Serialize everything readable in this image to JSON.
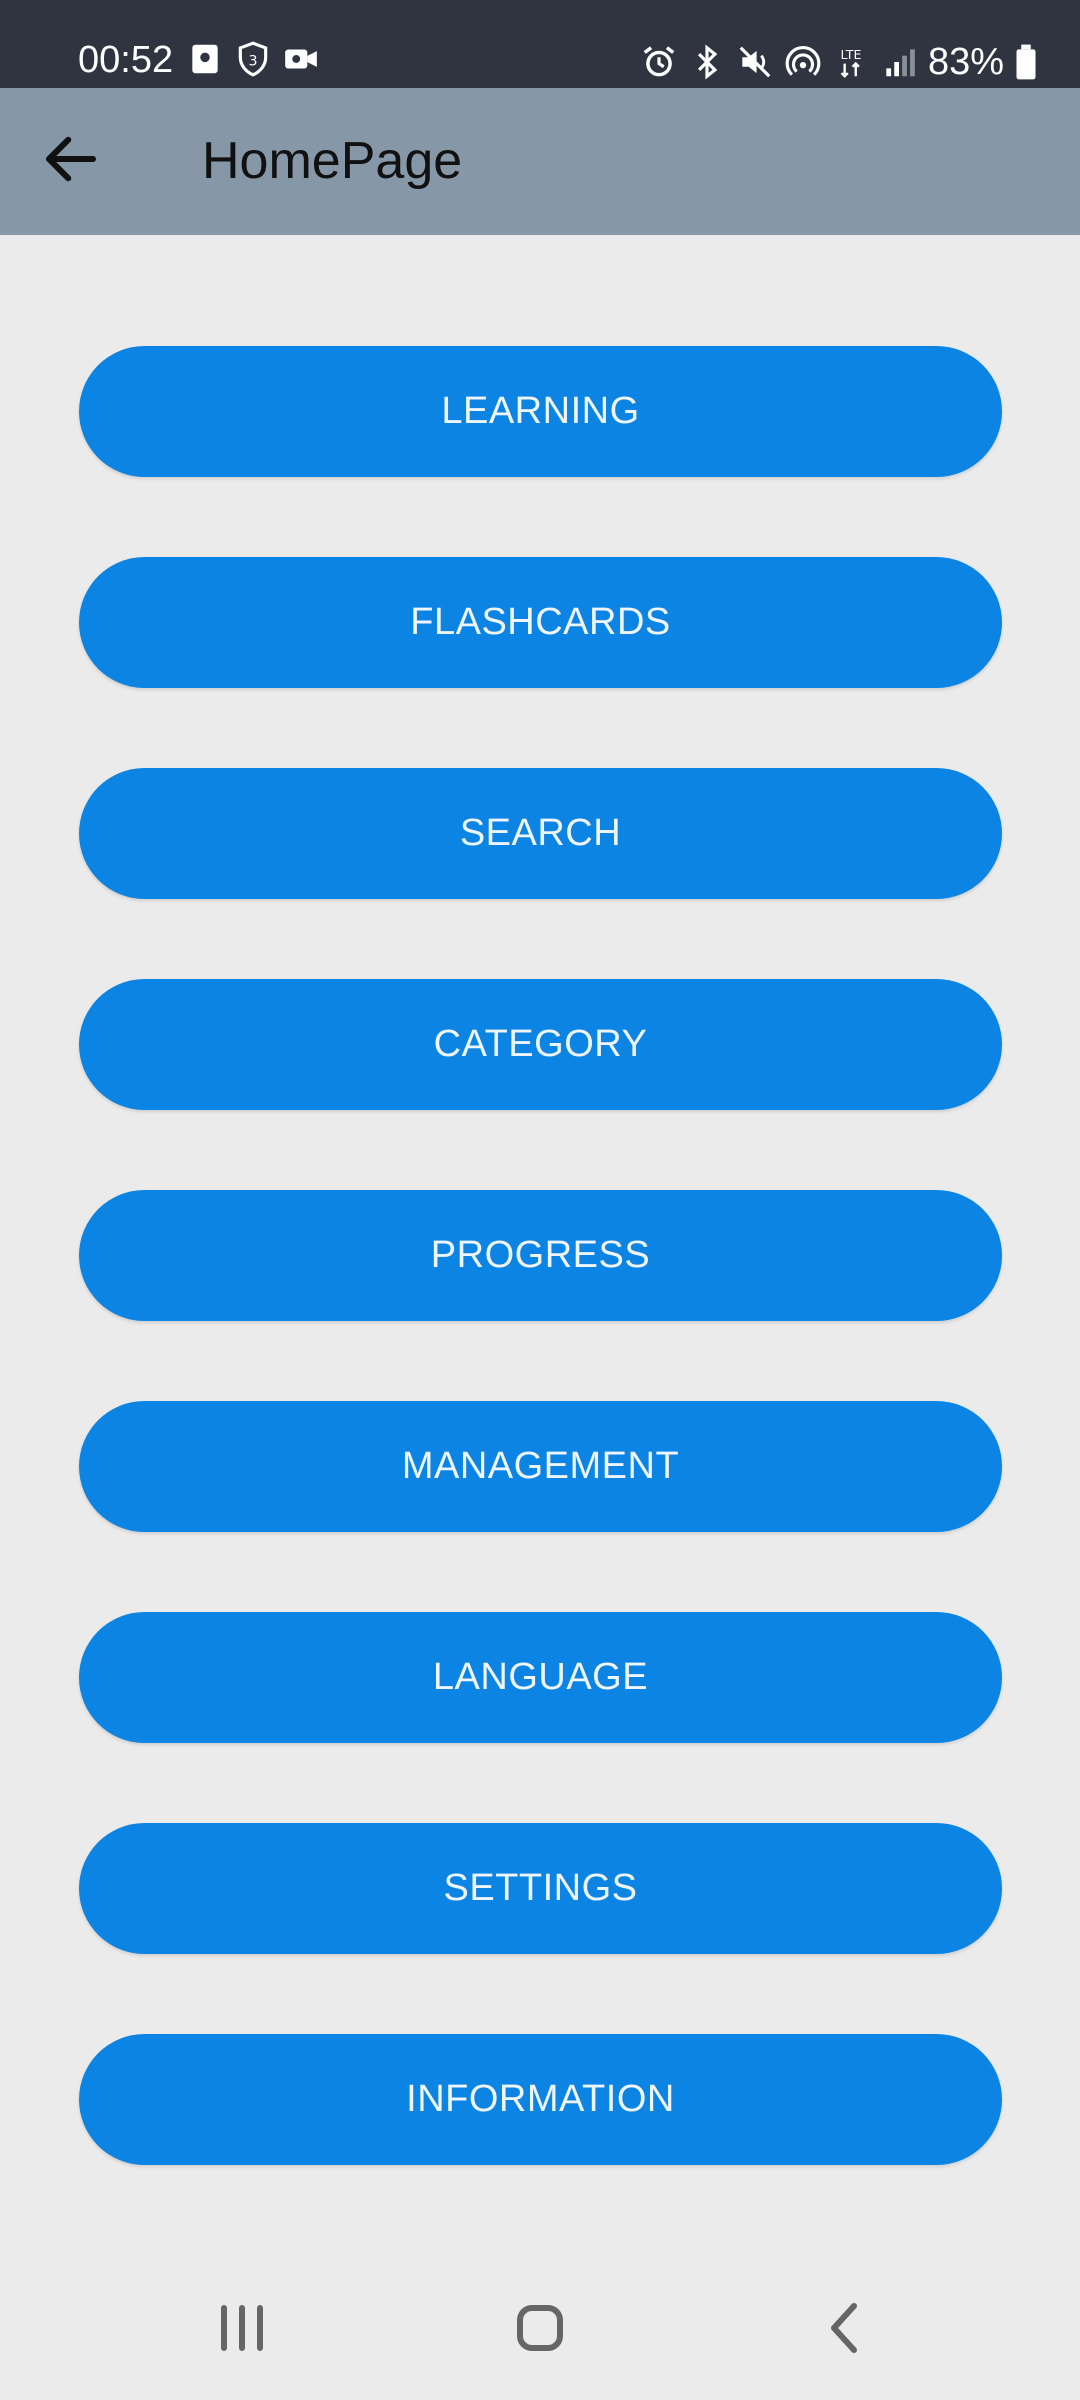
{
  "status_bar": {
    "time": "00:52",
    "battery_percent": "83%",
    "left_icons": [
      "notification-icon",
      "shield-3-icon",
      "video-record-icon"
    ],
    "right_icons": [
      "alarm-icon",
      "bluetooth-icon",
      "mute-icon",
      "hotspot-icon",
      "lte-icon",
      "signal-icon",
      "battery-icon"
    ]
  },
  "app_bar": {
    "title": "HomePage",
    "back_icon": "arrow-left-icon"
  },
  "menu": {
    "items": [
      {
        "label": "LEARNING"
      },
      {
        "label": "FLASHCARDS"
      },
      {
        "label": "SEARCH"
      },
      {
        "label": "CATEGORY"
      },
      {
        "label": "PROGRESS"
      },
      {
        "label": "MANAGEMENT"
      },
      {
        "label": "LANGUAGE"
      },
      {
        "label": "SETTINGS"
      },
      {
        "label": "INFORMATION"
      }
    ]
  },
  "navigation_bar": {
    "buttons": [
      "recent-apps-icon",
      "home-icon",
      "back-icon"
    ]
  },
  "colors": {
    "status_bar": "#2f3440",
    "app_bar": "#8697a8",
    "background": "#ebebeb",
    "button": "#0b84e4",
    "button_text": "#eef5fc"
  }
}
